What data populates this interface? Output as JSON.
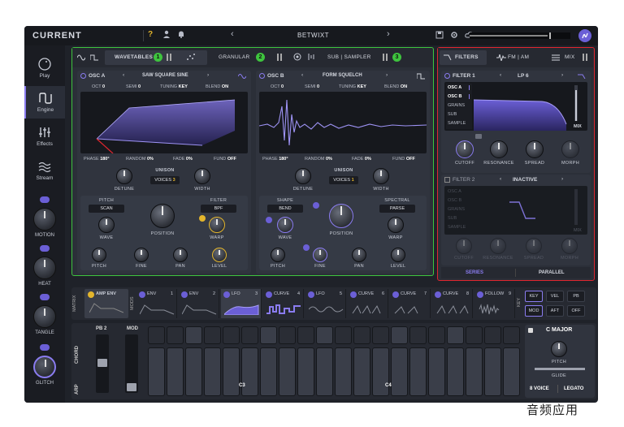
{
  "app": {
    "name": "CURRENT",
    "preset": "BETWIXT"
  },
  "header": {
    "help": "?",
    "prev": "‹",
    "next": "›"
  },
  "nav": [
    {
      "label": "Play",
      "icon": "play-icon"
    },
    {
      "label": "Engine",
      "icon": "engine-icon"
    },
    {
      "label": "Effects",
      "icon": "effects-icon"
    },
    {
      "label": "Stream",
      "icon": "stream-icon"
    }
  ],
  "macros": [
    {
      "label": "MOTION"
    },
    {
      "label": "HEAT"
    },
    {
      "label": "TANGLE"
    },
    {
      "label": "GLITCH"
    }
  ],
  "engine_tabs": {
    "wavetables": "WAVETABLES",
    "granular": "GRANULAR",
    "sub_sampler": "SUB | SAMPLER",
    "badges": [
      "1",
      "2",
      "3"
    ]
  },
  "oscA": {
    "title": "OSC A",
    "preset": "SAW SQUARE SINE",
    "oct": "OCT",
    "oct_v": "0",
    "semi": "SEMI",
    "semi_v": "0",
    "tuning": "TUNING",
    "tuning_v": "KEY",
    "blend": "BLEND",
    "blend_v": "ON",
    "phase": "PHASE",
    "phase_v": "180°",
    "random": "RANDOM",
    "random_v": "0%",
    "fade": "FADE",
    "fade_v": "0%",
    "fund": "FUND",
    "fund_v": "OFF",
    "detune": "DETUNE",
    "unison": "UNISON",
    "voices": "VOICES",
    "voices_v": "3",
    "width": "WIDTH",
    "pitch_lbl": "PITCH",
    "pitch_sel": "SCAN",
    "filter_lbl": "FILTER",
    "filter_sel": "BPF",
    "wave": "WAVE",
    "position": "POSITION",
    "warp": "WARP",
    "k1": "PITCH",
    "k2": "FINE",
    "k3": "PAN",
    "k4": "LEVEL"
  },
  "oscB": {
    "title": "OSC B",
    "preset": "FORM SQUELCH",
    "oct": "OCT",
    "oct_v": "0",
    "semi": "SEMI",
    "semi_v": "0",
    "tuning": "TUNING",
    "tuning_v": "KEY",
    "blend": "BLEND",
    "blend_v": "ON",
    "phase": "PHASE",
    "phase_v": "180°",
    "random": "RANDOM",
    "random_v": "0%",
    "fade": "FADE",
    "fade_v": "0%",
    "fund": "FUND",
    "fund_v": "OFF",
    "detune": "DETUNE",
    "unison": "UNISON",
    "voices": "VOICES",
    "voices_v": "1",
    "width": "WIDTH",
    "shape_lbl": "SHAPE",
    "shape_sel": "BEND",
    "spectral_lbl": "SPECTRAL",
    "spectral_sel": "PARSE",
    "wave": "WAVE",
    "position": "POSITION",
    "warp": "WARP",
    "k1": "PITCH",
    "k2": "FINE",
    "k3": "PAN",
    "k4": "LEVEL"
  },
  "filters": {
    "tab": "FILTERS",
    "fmam": "FM | AM",
    "mix": "MIX",
    "f1": {
      "title": "FILTER 1",
      "type": "LP 6",
      "sources": [
        "OSC A",
        "OSC B",
        "GRAINS",
        "SUB",
        "SAMPLE"
      ],
      "mix": "MIX",
      "knobs": [
        "CUTOFF",
        "RESONANCE",
        "SPREAD",
        "MORPH"
      ]
    },
    "f2": {
      "title": "FILTER 2",
      "type": "INACTIVE",
      "sources": [
        "OSC A",
        "OSC B",
        "GRAINS",
        "SUB",
        "SAMPLE"
      ],
      "mix": "MIX",
      "knobs": [
        "CUTOFF",
        "RESONANCE",
        "SPREAD",
        "MORPH"
      ]
    },
    "series": "SERIES",
    "parallel": "PARALLEL"
  },
  "mods": {
    "matrix": "MATRIX",
    "mods": "MODS",
    "key": "KEY",
    "slots": [
      {
        "label": "AMP ENV",
        "num": ""
      },
      {
        "label": "ENV",
        "num": "1"
      },
      {
        "label": "ENV",
        "num": "2"
      },
      {
        "label": "LFO",
        "num": "3"
      },
      {
        "label": "CURVE",
        "num": "4"
      },
      {
        "label": "LFO",
        "num": "5"
      },
      {
        "label": "CURVE",
        "num": "6"
      },
      {
        "label": "CURVE",
        "num": "7"
      },
      {
        "label": "CURVE",
        "num": "8"
      },
      {
        "label": "FOLLOW",
        "num": "9"
      }
    ],
    "keybtns": [
      "KEY",
      "VEL",
      "PB",
      "MOD",
      "AFT",
      "OFF"
    ]
  },
  "keys": {
    "chord": "CHORD",
    "arp": "ARP",
    "pb": "PB",
    "pb_v": "2",
    "mod": "MOD",
    "c3": "C3",
    "c4": "C4",
    "scale": "C MAJOR",
    "pitch": "PITCH",
    "glide": "GLIDE",
    "voices": "8 VOICE",
    "legato": "LEGATO"
  },
  "watermark": "音频应用",
  "colors": {
    "accent": "#6b5fd6",
    "highlight_green": "#3ec43e",
    "highlight_red": "#e0262f",
    "lfo_yellow": "#e3b52c"
  }
}
